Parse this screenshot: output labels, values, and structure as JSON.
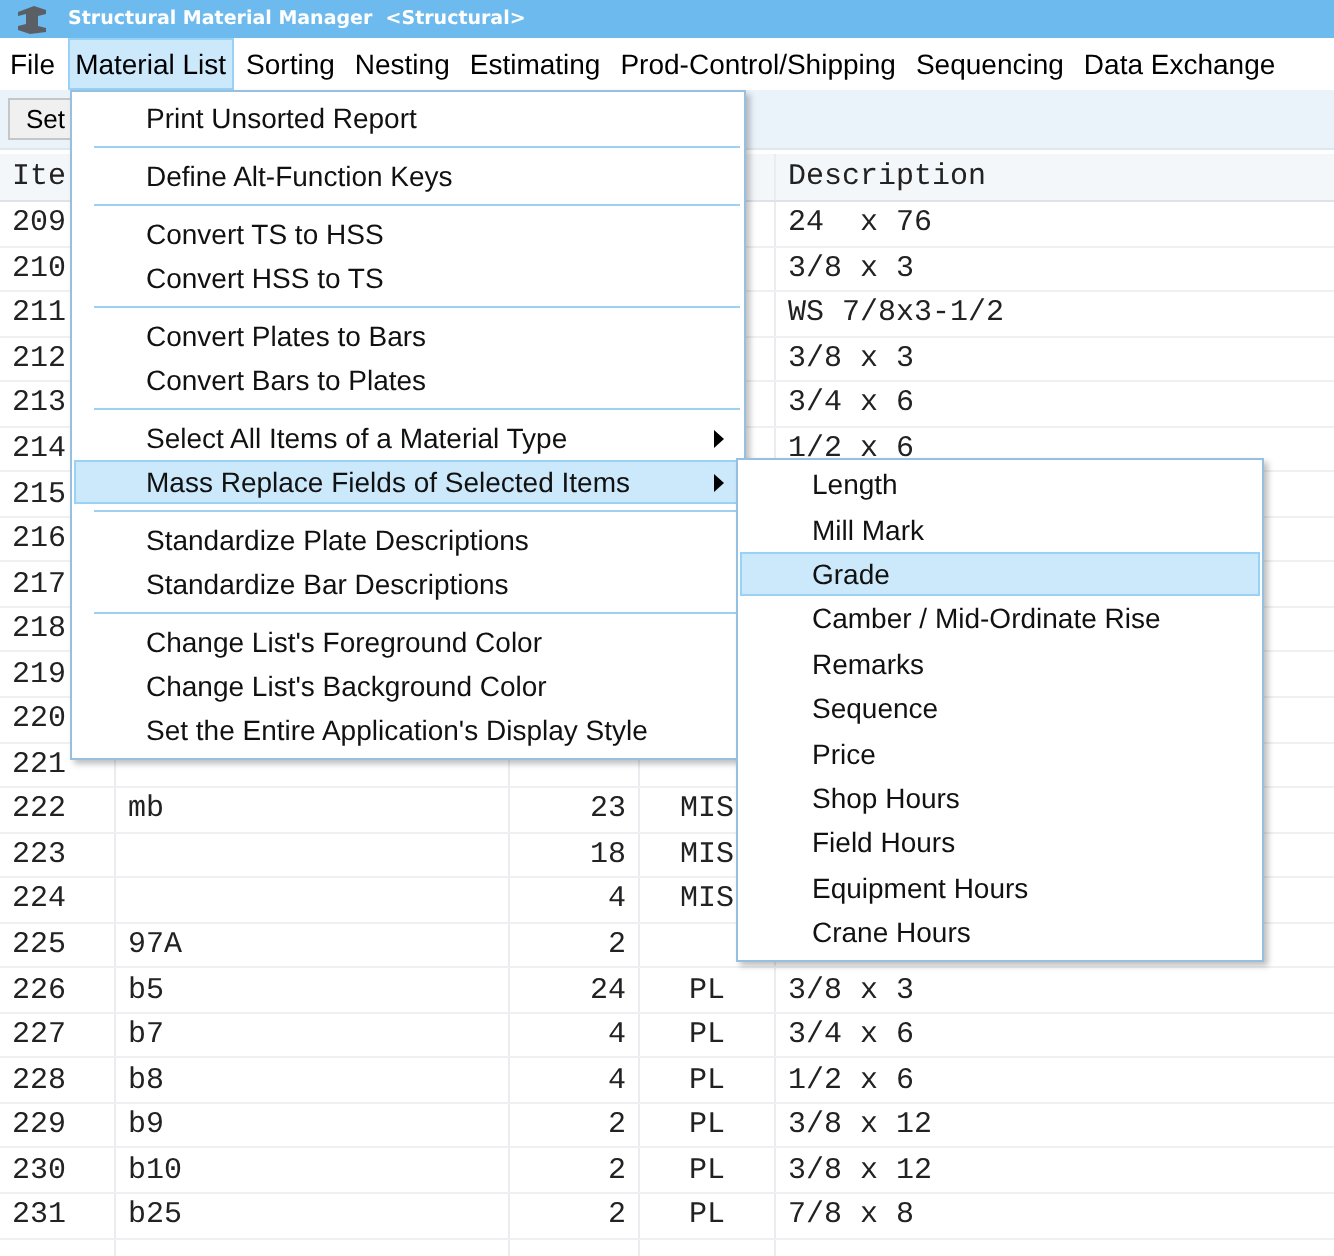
{
  "window": {
    "title": "Structural Material Manager  <Structural>"
  },
  "menu_bar": [
    {
      "label": "File",
      "selected": false
    },
    {
      "label": "Material List",
      "selected": true
    },
    {
      "label": "Sorting",
      "selected": false
    },
    {
      "label": "Nesting",
      "selected": false
    },
    {
      "label": "Estimating",
      "selected": false
    },
    {
      "label": "Prod-Control/Shipping",
      "selected": false
    },
    {
      "label": "Sequencing",
      "selected": false
    },
    {
      "label": "Data Exchange",
      "selected": false
    }
  ],
  "toolbar": {
    "buttons": [
      "Set"
    ]
  },
  "table": {
    "header": {
      "column_1": "Ite",
      "column_5": "Description"
    },
    "rows": [
      {
        "item": "209",
        "description": "24  x 76"
      },
      {
        "item": "210",
        "description": "3/8 x 3"
      },
      {
        "item": "211",
        "description": "WS 7/8x3-1/2"
      },
      {
        "item": "212",
        "description": "3/8 x 3"
      },
      {
        "item": "213",
        "description": "3/4 x 6"
      },
      {
        "item": "214",
        "description": "1/2 x 6"
      },
      {
        "item": "215"
      },
      {
        "item": "216"
      },
      {
        "item": "217"
      },
      {
        "item": "218"
      },
      {
        "item": "219"
      },
      {
        "item": "220"
      },
      {
        "item": "221"
      },
      {
        "item": "222",
        "mark": "mb",
        "qty": "23",
        "type": "MIS"
      },
      {
        "item": "223",
        "qty": "18",
        "type": "MIS"
      },
      {
        "item": "224",
        "qty": "4",
        "type": "MIS"
      },
      {
        "item": "225",
        "mark": "97A",
        "qty": "2"
      },
      {
        "item": "226",
        "mark": "b5",
        "qty": "24",
        "type": "PL",
        "description": "3/8 x 3"
      },
      {
        "item": "227",
        "mark": "b7",
        "qty": "4",
        "type": "PL",
        "description": "3/4 x 6"
      },
      {
        "item": "228",
        "mark": "b8",
        "qty": "4",
        "type": "PL",
        "description": "1/2 x 6"
      },
      {
        "item": "229",
        "mark": "b9",
        "qty": "2",
        "type": "PL",
        "description": "3/8 x 12"
      },
      {
        "item": "230",
        "mark": "b10",
        "qty": "2",
        "type": "PL",
        "description": "3/8 x 12"
      },
      {
        "item": "231",
        "mark": "b25",
        "qty": "2",
        "type": "PL",
        "description": "7/8 x 8"
      }
    ]
  },
  "dropdown_menu": {
    "groups": [
      [
        {
          "label": "Print Unsorted Report",
          "selected": false,
          "has_submenu": false
        }
      ],
      [
        {
          "label": "Define Alt-Function Keys",
          "selected": false,
          "has_submenu": false
        }
      ],
      [
        {
          "label": "Convert TS to HSS",
          "selected": false,
          "has_submenu": false
        },
        {
          "label": "Convert HSS to TS",
          "selected": false,
          "has_submenu": false
        }
      ],
      [
        {
          "label": "Convert Plates to Bars",
          "selected": false,
          "has_submenu": false
        },
        {
          "label": "Convert Bars to Plates",
          "selected": false,
          "has_submenu": false
        }
      ],
      [
        {
          "label": "Select All Items of a Material Type",
          "selected": false,
          "has_submenu": true
        },
        {
          "label": "Mass Replace Fields of Selected Items",
          "selected": true,
          "has_submenu": true
        }
      ],
      [
        {
          "label": "Standardize Plate Descriptions",
          "selected": false,
          "has_submenu": false
        },
        {
          "label": "Standardize Bar Descriptions",
          "selected": false,
          "has_submenu": false
        }
      ],
      [
        {
          "label": "Change List's Foreground Color",
          "selected": false,
          "has_submenu": false
        },
        {
          "label": "Change List's Background Color",
          "selected": false,
          "has_submenu": false
        },
        {
          "label": "Set the Entire Application's Display Style",
          "selected": false,
          "has_submenu": false
        }
      ]
    ]
  },
  "submenu": {
    "items": [
      {
        "label": "Length",
        "selected": false
      },
      {
        "label": "Mill Mark",
        "selected": false
      },
      {
        "label": "Grade",
        "selected": true
      },
      {
        "label": "Camber / Mid-Ordinate Rise",
        "selected": false
      },
      {
        "label": "Remarks",
        "selected": false
      },
      {
        "label": "Sequence",
        "selected": false
      },
      {
        "label": "Price",
        "selected": false
      },
      {
        "label": "Shop Hours",
        "selected": false
      },
      {
        "label": "Field Hours",
        "selected": false
      },
      {
        "label": "Equipment Hours",
        "selected": false
      },
      {
        "label": "Crane Hours",
        "selected": false
      }
    ]
  }
}
